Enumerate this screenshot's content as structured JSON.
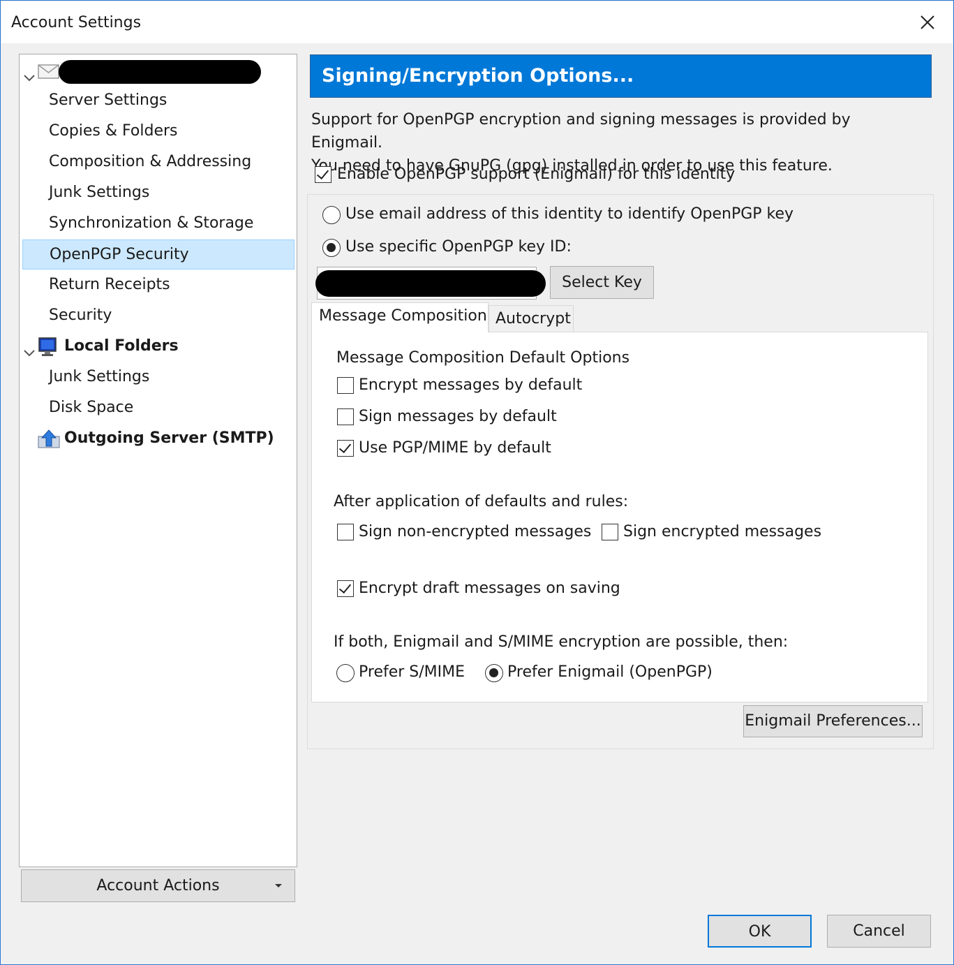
{
  "window": {
    "title": "Account Settings",
    "close_icon": "close-icon"
  },
  "tree": {
    "account_label": "",
    "items": [
      {
        "label": "Server Settings"
      },
      {
        "label": "Copies & Folders"
      },
      {
        "label": "Composition & Addressing"
      },
      {
        "label": "Junk Settings"
      },
      {
        "label": "Synchronization & Storage"
      },
      {
        "label": "OpenPGP Security",
        "selected": true
      },
      {
        "label": "Return Receipts"
      },
      {
        "label": "Security"
      }
    ],
    "local_folders": {
      "label": "Local Folders",
      "items": [
        {
          "label": "Junk Settings"
        },
        {
          "label": "Disk Space"
        }
      ]
    },
    "outgoing": {
      "label": "Outgoing Server (SMTP)"
    }
  },
  "account_actions": {
    "label": "Account Actions"
  },
  "main": {
    "header": "Signing/Encryption Options...",
    "description_line1": "Support for OpenPGP encryption and signing messages is provided by Enigmail.",
    "description_line2": "You need to have GnuPG (gpg) installed in order to use this feature.",
    "enable_openpgp": {
      "label": "Enable OpenPGP support (Enigmail) for this identity",
      "checked": true
    },
    "key_mode": {
      "use_email": {
        "label": "Use email address of this identity to identify OpenPGP key",
        "selected": false
      },
      "use_key_id": {
        "label": "Use specific OpenPGP key ID:",
        "selected": true
      }
    },
    "key_id_value": "",
    "select_key_label": "Select Key",
    "tabs": [
      {
        "label": "Message Composition",
        "active": true
      },
      {
        "label": "Autocrypt",
        "active": false
      }
    ],
    "composition": {
      "heading": "Message Composition Default Options",
      "encrypt_default": {
        "label": "Encrypt messages by default",
        "checked": false
      },
      "sign_default": {
        "label": "Sign messages by default",
        "checked": false
      },
      "pgpmime_default": {
        "label": "Use PGP/MIME by default",
        "checked": true
      },
      "after_heading": "After application of defaults and rules:",
      "sign_nonenc": {
        "label": "Sign non-encrypted messages",
        "checked": false
      },
      "sign_enc": {
        "label": "Sign encrypted messages",
        "checked": false
      },
      "encrypt_drafts": {
        "label": "Encrypt draft messages on saving",
        "checked": true
      },
      "both_heading": "If both, Enigmail and S/MIME encryption are possible, then:",
      "prefer_smime": {
        "label": "Prefer S/MIME",
        "selected": false
      },
      "prefer_enigmail": {
        "label": "Prefer Enigmail (OpenPGP)",
        "selected": true
      }
    },
    "enigmail_prefs_label": "Enigmail Preferences..."
  },
  "footer": {
    "ok_label": "OK",
    "cancel_label": "Cancel"
  }
}
